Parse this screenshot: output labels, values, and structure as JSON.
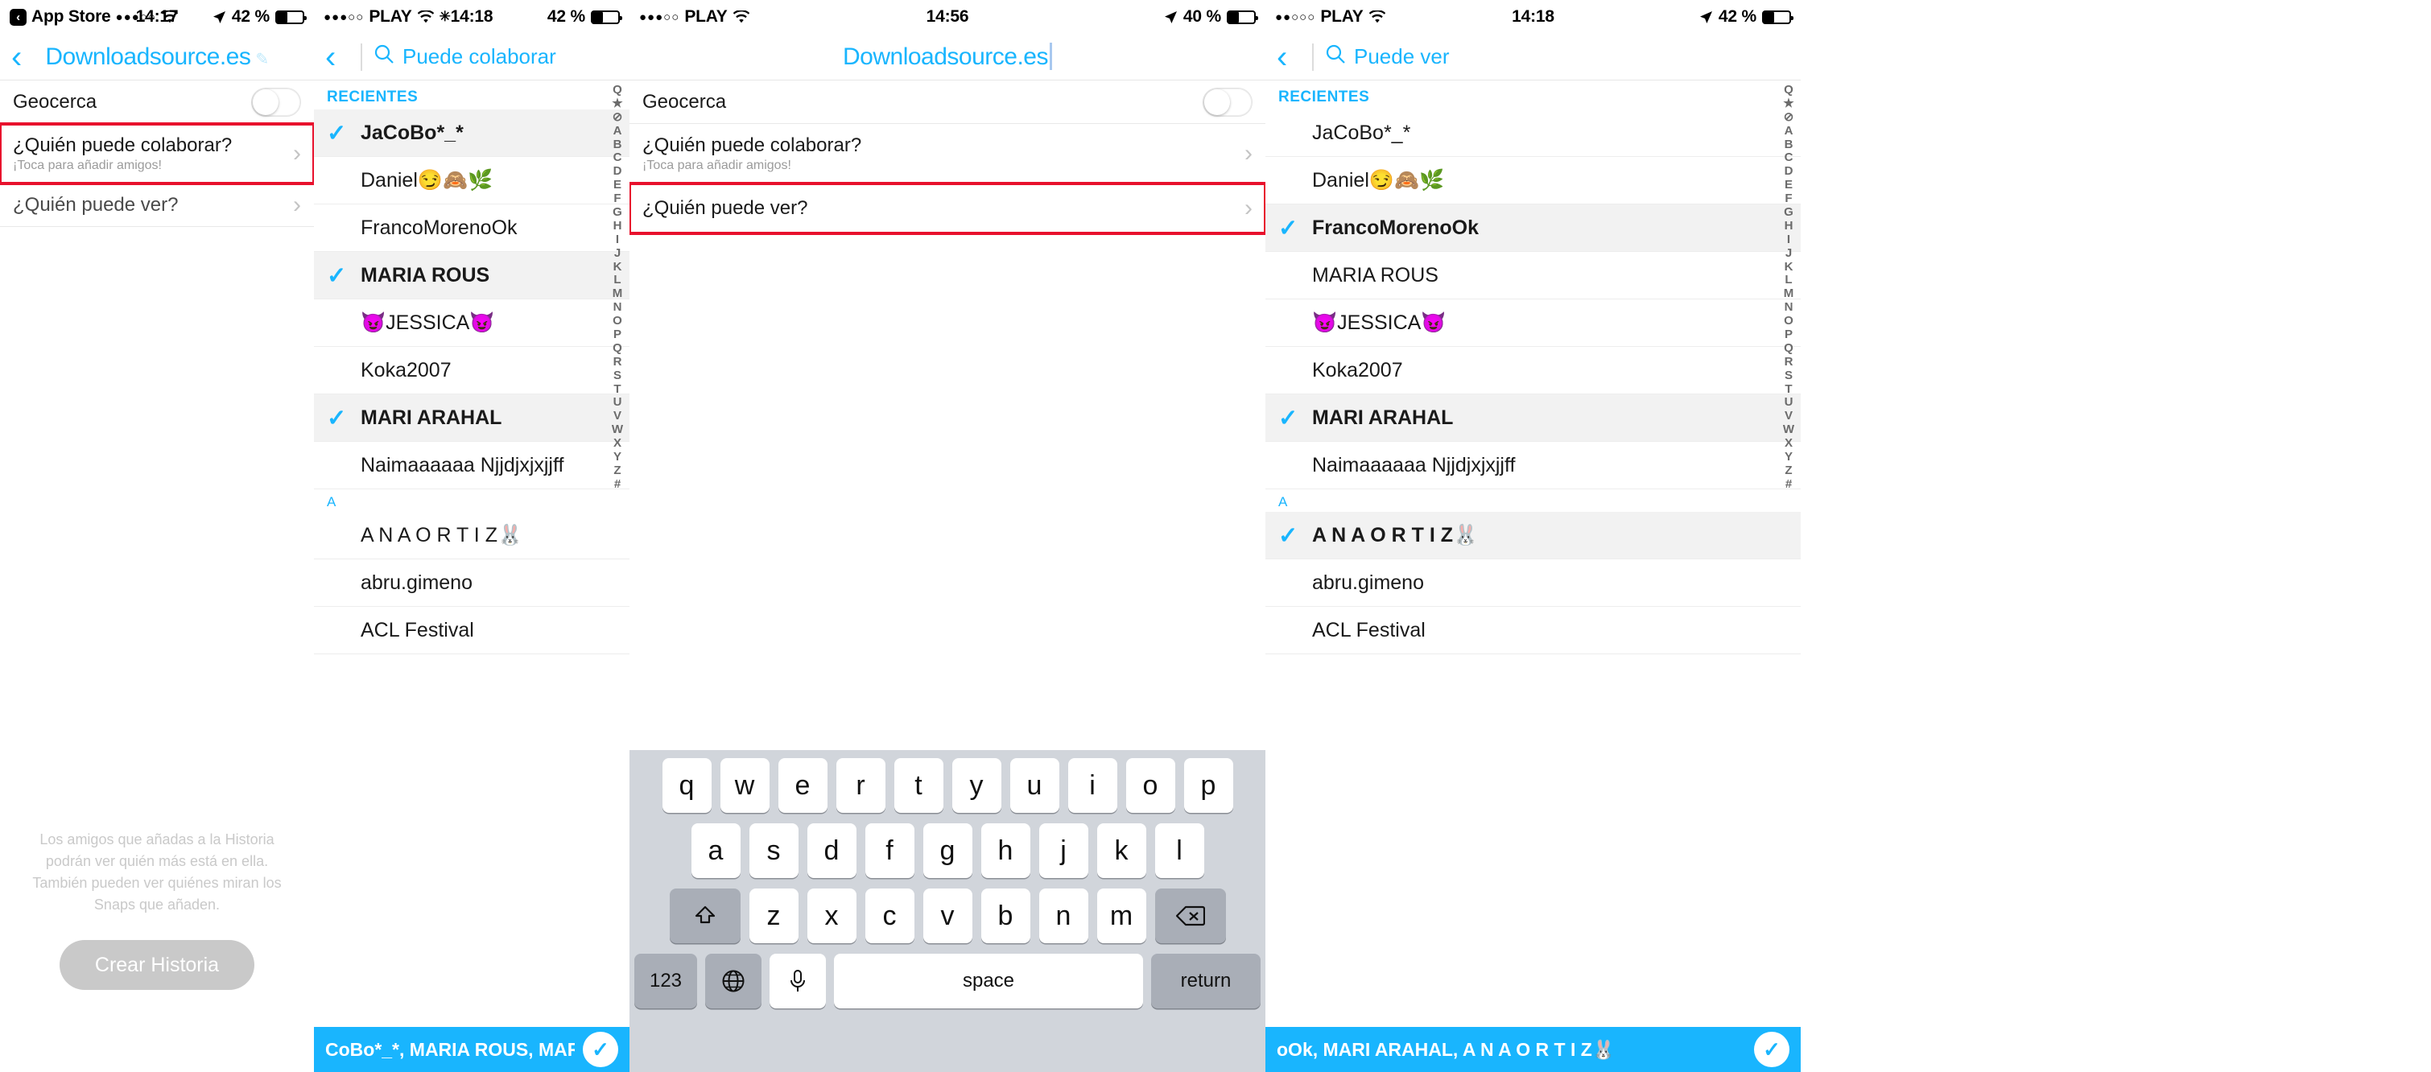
{
  "panels": [
    {
      "id": "story-settings",
      "status": {
        "back_app": "App Store",
        "carrier_dots": "●●●○○",
        "wifi": "wifi-icon",
        "time": "14:17",
        "location": "location-arrow-icon",
        "battery": "42 %"
      },
      "nav": {
        "back": "chevron-left-icon",
        "title": "Downloadsource.es",
        "edit": "pencil-icon"
      },
      "rows": [
        {
          "label": "Geocerca",
          "control": "toggle",
          "state": "off"
        },
        {
          "label": "¿Quién puede colaborar?",
          "sub": "¡Toca para añadir amigos!",
          "control": "chevron",
          "highlight": true
        },
        {
          "label": "¿Quién puede ver?",
          "control": "chevron",
          "highlight": false,
          "muted": true
        }
      ],
      "footnote": "Los amigos que añadas a la Historia podrán ver quién más está en ella. También pueden ver quiénes miran los Snaps que añaden.",
      "cta": "Crear Historia"
    },
    {
      "id": "puede-colaborar",
      "status": {
        "carrier_dots": "●●●○○",
        "carrier": "PLAY",
        "wifi": "wifi-icon",
        "activity": "activity-indicator-icon",
        "time": "14:18",
        "battery": "42 %"
      },
      "nav": {
        "back": "chevron-left-icon",
        "search_icon": "search-icon",
        "title": "Puede colaborar"
      },
      "section_header": "RECIENTES",
      "friends": [
        {
          "name": "JaCoBo*_*",
          "selected": true
        },
        {
          "name": "Daniel😏🙈🌿",
          "selected": false
        },
        {
          "name": "FrancoMorenoOk",
          "selected": false
        },
        {
          "name": "MARIA ROUS",
          "selected": true
        },
        {
          "name": "😈JESSICA😈",
          "selected": false
        },
        {
          "name": "Koka2007",
          "selected": false
        },
        {
          "name": "MARI ARAHAL",
          "selected": true
        },
        {
          "name": "Naimaaaaaa Njjdjxjxjjff",
          "selected": false
        }
      ],
      "alpha_header": "A",
      "friends_a": [
        {
          "name": "A N A  O R T I Z🐰",
          "selected": false
        },
        {
          "name": "abru.gimeno",
          "selected": false
        },
        {
          "name": "ACL Festival",
          "selected": false
        }
      ],
      "index": [
        "Q",
        "★",
        "⊘",
        "A",
        "B",
        "C",
        "D",
        "E",
        "F",
        "G",
        "H",
        "I",
        "J",
        "K",
        "L",
        "M",
        "N",
        "O",
        "P",
        "Q",
        "R",
        "S",
        "T",
        "U",
        "V",
        "W",
        "X",
        "Y",
        "Z",
        "#"
      ],
      "bottom": {
        "names": "CoBo*_*, MARIA ROUS, MARI ARAHAL",
        "confirm": "✓"
      }
    },
    {
      "id": "story-settings-keyboard",
      "status": {
        "carrier_dots": "●●●○○",
        "carrier": "PLAY",
        "wifi": "wifi-icon",
        "time": "14:56",
        "location": "location-arrow-icon",
        "battery": "40 %"
      },
      "nav": {
        "back": "chevron-left-icon",
        "title": "Downloadsource.es",
        "caret": "text-cursor"
      },
      "rows": [
        {
          "label": "Geocerca",
          "control": "toggle",
          "state": "off"
        },
        {
          "label": "¿Quién puede colaborar?",
          "sub": "¡Toca para añadir amigos!",
          "control": "chevron",
          "highlight": false
        },
        {
          "label": "¿Quién puede ver?",
          "control": "chevron",
          "highlight": true
        }
      ],
      "keyboard": {
        "row1": [
          "q",
          "w",
          "e",
          "r",
          "t",
          "y",
          "u",
          "i",
          "o",
          "p"
        ],
        "row2": [
          "a",
          "s",
          "d",
          "f",
          "g",
          "h",
          "j",
          "k",
          "l"
        ],
        "row3_shift": "shift-icon",
        "row3": [
          "z",
          "x",
          "c",
          "v",
          "b",
          "n",
          "m"
        ],
        "row3_delete": "backspace-icon",
        "row4": {
          "numbers": "123",
          "globe": "globe-icon",
          "mic": "microphone-icon",
          "space": "space",
          "return": "return"
        }
      }
    },
    {
      "id": "puede-ver",
      "status": {
        "carrier_dots": "●●○○○",
        "carrier": "PLAY",
        "wifi": "wifi-icon",
        "time": "14:18",
        "location": "location-arrow-icon",
        "battery": "42 %"
      },
      "nav": {
        "back": "chevron-left-icon",
        "search_icon": "search-icon",
        "title": "Puede ver"
      },
      "section_header": "RECIENTES",
      "friends": [
        {
          "name": "JaCoBo*_*",
          "selected": false
        },
        {
          "name": "Daniel😏🙈🌿",
          "selected": false
        },
        {
          "name": "FrancoMorenoOk",
          "selected": true
        },
        {
          "name": "MARIA ROUS",
          "selected": false
        },
        {
          "name": "😈JESSICA😈",
          "selected": false
        },
        {
          "name": "Koka2007",
          "selected": false
        },
        {
          "name": "MARI ARAHAL",
          "selected": true
        },
        {
          "name": "Naimaaaaaa Njjdjxjxjjff",
          "selected": false
        }
      ],
      "alpha_header": "A",
      "friends_a": [
        {
          "name": "A N A  O R T I Z🐰",
          "selected": true
        },
        {
          "name": "abru.gimeno",
          "selected": false
        },
        {
          "name": "ACL Festival",
          "selected": false
        }
      ],
      "index": [
        "Q",
        "★",
        "⊘",
        "A",
        "B",
        "C",
        "D",
        "E",
        "F",
        "G",
        "H",
        "I",
        "J",
        "K",
        "L",
        "M",
        "N",
        "O",
        "P",
        "Q",
        "R",
        "S",
        "T",
        "U",
        "V",
        "W",
        "X",
        "Y",
        "Z",
        "#"
      ],
      "bottom": {
        "names": "oOk, MARI ARAHAL, A N A  O R T I Z🐰",
        "confirm": "✓"
      }
    }
  ]
}
